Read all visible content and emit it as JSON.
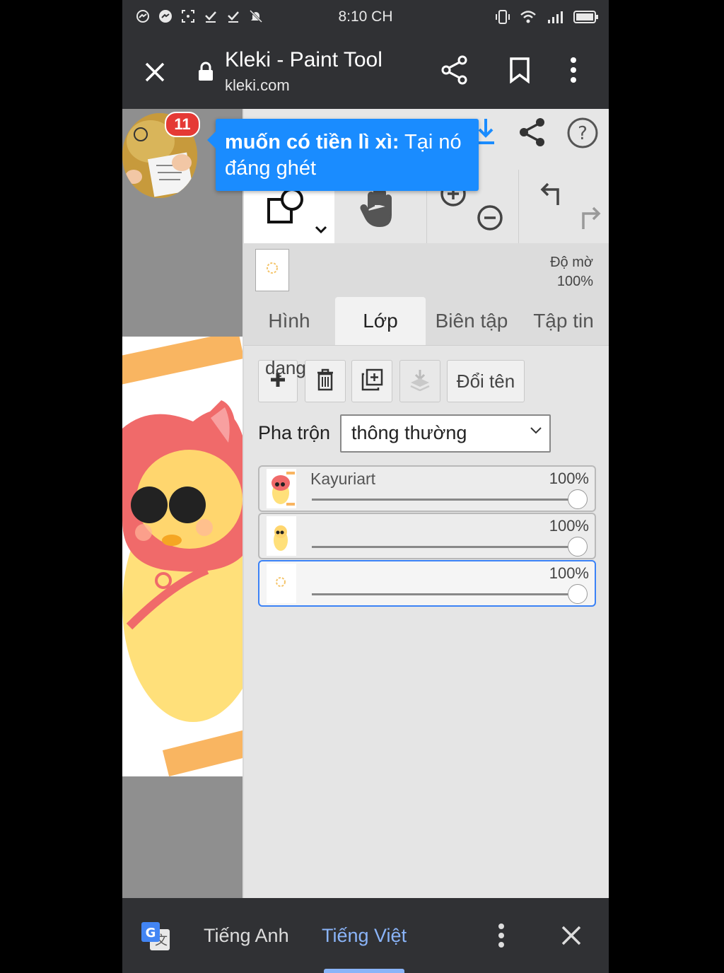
{
  "status_bar": {
    "time": "8:10 CH"
  },
  "browser": {
    "title": "Kleki - Paint Tool",
    "url": "kleki.com"
  },
  "chat_head": {
    "badge_count": "11"
  },
  "tooltip": {
    "bold": "muốn có tiền lì xì:",
    "rest": " Tại nó đáng ghét"
  },
  "panel": {
    "opacity_label": "Độ mờ",
    "opacity_value": "100%",
    "tabs": [
      "Hình",
      "Lớp",
      "Biên tập",
      "Tập tin"
    ],
    "active_tab": "Lớp",
    "overlay_text": "dạng",
    "rename_button": "Đổi tên",
    "blend_label": "Pha trộn",
    "blend_value": "thông thường",
    "layers": [
      {
        "name": "Kayuriart",
        "opacity": "100%"
      },
      {
        "name": "",
        "opacity": "100%"
      },
      {
        "name": "",
        "opacity": "100%"
      }
    ]
  },
  "translate_bar": {
    "source_lang": "Tiếng Anh",
    "target_lang": "Tiếng Việt"
  },
  "colors": {
    "accent_blue": "#1a8cff",
    "dark_bar": "#303134",
    "active_lang": "#8ab4f8",
    "badge_red": "#e53935"
  }
}
